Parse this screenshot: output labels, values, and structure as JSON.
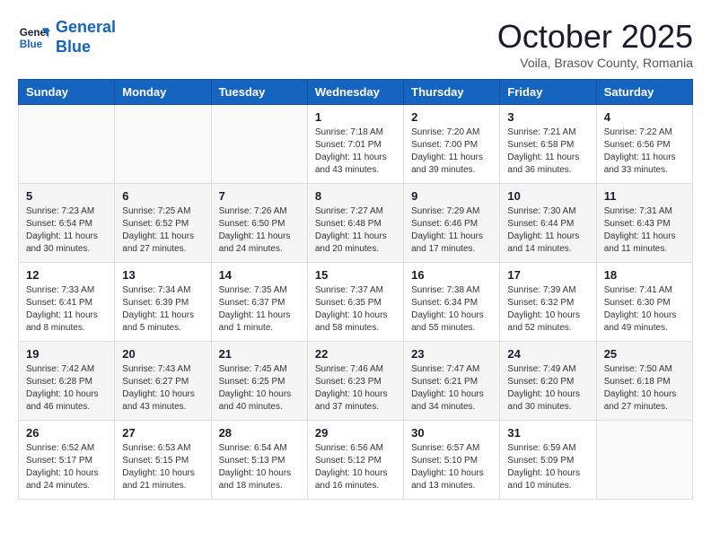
{
  "header": {
    "logo_line1": "General",
    "logo_line2": "Blue",
    "month": "October 2025",
    "location": "Voila, Brasov County, Romania"
  },
  "weekdays": [
    "Sunday",
    "Monday",
    "Tuesday",
    "Wednesday",
    "Thursday",
    "Friday",
    "Saturday"
  ],
  "weeks": [
    [
      {
        "day": "",
        "info": ""
      },
      {
        "day": "",
        "info": ""
      },
      {
        "day": "",
        "info": ""
      },
      {
        "day": "1",
        "info": "Sunrise: 7:18 AM\nSunset: 7:01 PM\nDaylight: 11 hours and 43 minutes."
      },
      {
        "day": "2",
        "info": "Sunrise: 7:20 AM\nSunset: 7:00 PM\nDaylight: 11 hours and 39 minutes."
      },
      {
        "day": "3",
        "info": "Sunrise: 7:21 AM\nSunset: 6:58 PM\nDaylight: 11 hours and 36 minutes."
      },
      {
        "day": "4",
        "info": "Sunrise: 7:22 AM\nSunset: 6:56 PM\nDaylight: 11 hours and 33 minutes."
      }
    ],
    [
      {
        "day": "5",
        "info": "Sunrise: 7:23 AM\nSunset: 6:54 PM\nDaylight: 11 hours and 30 minutes."
      },
      {
        "day": "6",
        "info": "Sunrise: 7:25 AM\nSunset: 6:52 PM\nDaylight: 11 hours and 27 minutes."
      },
      {
        "day": "7",
        "info": "Sunrise: 7:26 AM\nSunset: 6:50 PM\nDaylight: 11 hours and 24 minutes."
      },
      {
        "day": "8",
        "info": "Sunrise: 7:27 AM\nSunset: 6:48 PM\nDaylight: 11 hours and 20 minutes."
      },
      {
        "day": "9",
        "info": "Sunrise: 7:29 AM\nSunset: 6:46 PM\nDaylight: 11 hours and 17 minutes."
      },
      {
        "day": "10",
        "info": "Sunrise: 7:30 AM\nSunset: 6:44 PM\nDaylight: 11 hours and 14 minutes."
      },
      {
        "day": "11",
        "info": "Sunrise: 7:31 AM\nSunset: 6:43 PM\nDaylight: 11 hours and 11 minutes."
      }
    ],
    [
      {
        "day": "12",
        "info": "Sunrise: 7:33 AM\nSunset: 6:41 PM\nDaylight: 11 hours and 8 minutes."
      },
      {
        "day": "13",
        "info": "Sunrise: 7:34 AM\nSunset: 6:39 PM\nDaylight: 11 hours and 5 minutes."
      },
      {
        "day": "14",
        "info": "Sunrise: 7:35 AM\nSunset: 6:37 PM\nDaylight: 11 hours and 1 minute."
      },
      {
        "day": "15",
        "info": "Sunrise: 7:37 AM\nSunset: 6:35 PM\nDaylight: 10 hours and 58 minutes."
      },
      {
        "day": "16",
        "info": "Sunrise: 7:38 AM\nSunset: 6:34 PM\nDaylight: 10 hours and 55 minutes."
      },
      {
        "day": "17",
        "info": "Sunrise: 7:39 AM\nSunset: 6:32 PM\nDaylight: 10 hours and 52 minutes."
      },
      {
        "day": "18",
        "info": "Sunrise: 7:41 AM\nSunset: 6:30 PM\nDaylight: 10 hours and 49 minutes."
      }
    ],
    [
      {
        "day": "19",
        "info": "Sunrise: 7:42 AM\nSunset: 6:28 PM\nDaylight: 10 hours and 46 minutes."
      },
      {
        "day": "20",
        "info": "Sunrise: 7:43 AM\nSunset: 6:27 PM\nDaylight: 10 hours and 43 minutes."
      },
      {
        "day": "21",
        "info": "Sunrise: 7:45 AM\nSunset: 6:25 PM\nDaylight: 10 hours and 40 minutes."
      },
      {
        "day": "22",
        "info": "Sunrise: 7:46 AM\nSunset: 6:23 PM\nDaylight: 10 hours and 37 minutes."
      },
      {
        "day": "23",
        "info": "Sunrise: 7:47 AM\nSunset: 6:21 PM\nDaylight: 10 hours and 34 minutes."
      },
      {
        "day": "24",
        "info": "Sunrise: 7:49 AM\nSunset: 6:20 PM\nDaylight: 10 hours and 30 minutes."
      },
      {
        "day": "25",
        "info": "Sunrise: 7:50 AM\nSunset: 6:18 PM\nDaylight: 10 hours and 27 minutes."
      }
    ],
    [
      {
        "day": "26",
        "info": "Sunrise: 6:52 AM\nSunset: 5:17 PM\nDaylight: 10 hours and 24 minutes."
      },
      {
        "day": "27",
        "info": "Sunrise: 6:53 AM\nSunset: 5:15 PM\nDaylight: 10 hours and 21 minutes."
      },
      {
        "day": "28",
        "info": "Sunrise: 6:54 AM\nSunset: 5:13 PM\nDaylight: 10 hours and 18 minutes."
      },
      {
        "day": "29",
        "info": "Sunrise: 6:56 AM\nSunset: 5:12 PM\nDaylight: 10 hours and 16 minutes."
      },
      {
        "day": "30",
        "info": "Sunrise: 6:57 AM\nSunset: 5:10 PM\nDaylight: 10 hours and 13 minutes."
      },
      {
        "day": "31",
        "info": "Sunrise: 6:59 AM\nSunset: 5:09 PM\nDaylight: 10 hours and 10 minutes."
      },
      {
        "day": "",
        "info": ""
      }
    ]
  ]
}
